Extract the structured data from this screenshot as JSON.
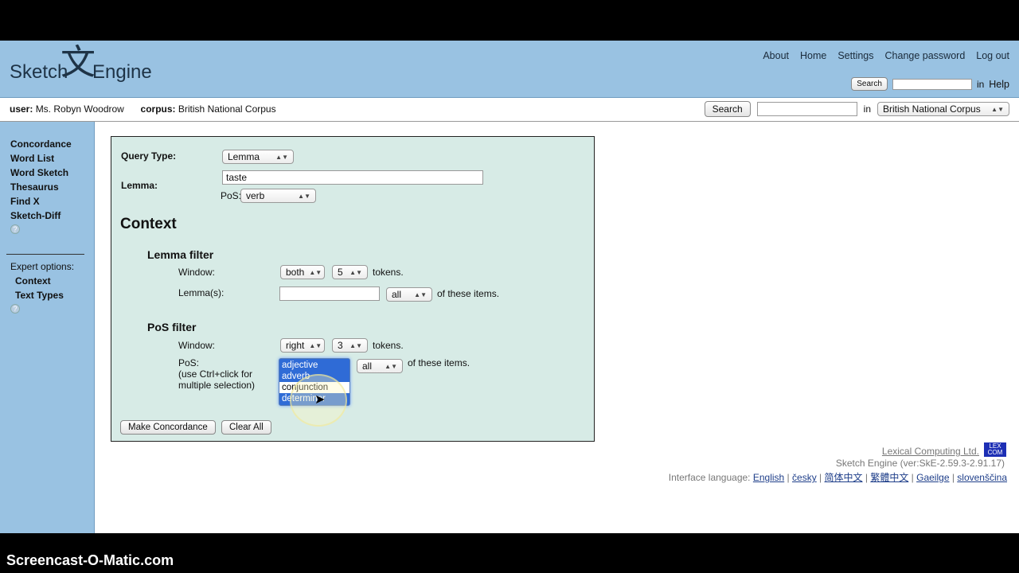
{
  "logo": {
    "word1": "Sketch",
    "glyph": "文",
    "word2": "Engine"
  },
  "topnav": [
    "About",
    "Home",
    "Settings",
    "Change password",
    "Log out"
  ],
  "topsearch": {
    "button": "Search",
    "in": "in",
    "help": "Help"
  },
  "infobar": {
    "user_label": "user:",
    "user_value": "Ms. Robyn Woodrow",
    "corpus_label": "corpus:",
    "corpus_value": "British National Corpus",
    "search_button": "Search",
    "in": "in",
    "corpus_select": "British National Corpus"
  },
  "sidebar": {
    "items": [
      "Concordance",
      "Word List",
      "Word Sketch",
      "Thesaurus",
      "Find X",
      "Sketch-Diff"
    ],
    "help": "?",
    "expert_label": "Expert options:",
    "expert_items": [
      "Context",
      "Text Types"
    ],
    "help2": "?"
  },
  "form": {
    "query_type_label": "Query Type:",
    "query_type_value": "Lemma",
    "lemma_label": "Lemma:",
    "lemma_value": "taste",
    "pos_label": "PoS:",
    "pos_value": "verb",
    "context_title": "Context",
    "lemma_filter": {
      "title": "Lemma filter",
      "window_label": "Window:",
      "window_dir": "both",
      "window_n": "5",
      "tokens": "tokens.",
      "lemmas_label": "Lemma(s):",
      "lemmas_value": "",
      "quant": "all",
      "of_items": "of these items."
    },
    "pos_filter": {
      "title": "PoS filter",
      "window_label": "Window:",
      "window_dir": "right",
      "window_n": "3",
      "tokens": "tokens.",
      "pos_label": "PoS:",
      "pos_hint1": "(use Ctrl+click for",
      "pos_hint2": "multiple selection)",
      "options": [
        {
          "label": "adjective",
          "selected": true
        },
        {
          "label": "adverb",
          "selected": true
        },
        {
          "label": "conjunction",
          "selected": false
        },
        {
          "label": "determiner",
          "selected": true
        }
      ],
      "quant": "all",
      "of_items": "of these items."
    },
    "make_button": "Make Concordance",
    "clear_button": "Clear All"
  },
  "footer": {
    "company": "Lexical Computing Ltd.",
    "lexcom_line1": "LEX",
    "lexcom_line2": "COM",
    "version": "Sketch Engine (ver:SkE-2.59.3-2.91.17)",
    "lang_label": "Interface language:",
    "languages": [
      "English",
      "česky",
      "简体中文",
      "繁體中文",
      "Gaeilge",
      "slovenščina"
    ]
  },
  "watermark": "Screencast-O-Matic.com"
}
